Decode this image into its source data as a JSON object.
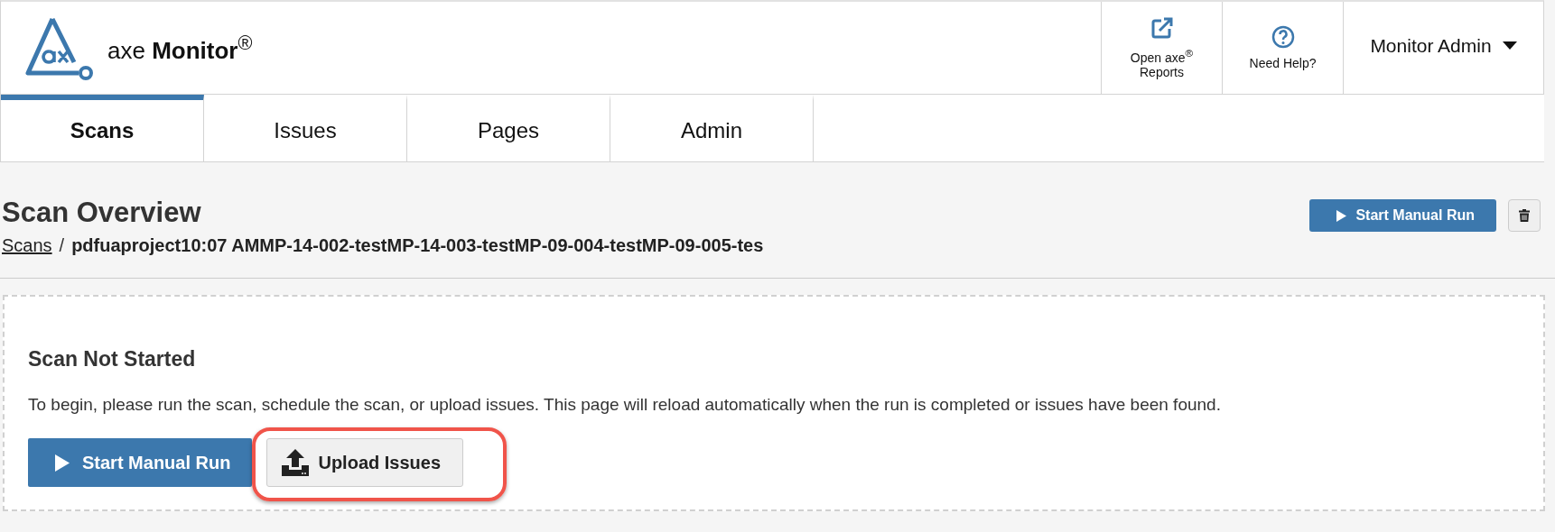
{
  "header": {
    "logo_text": "axe **Monitor**$^{®}$",
    "actions": [
      {
        "kind": "external",
        "label": "Open axe$^{®}$ Reports"
      },
      {
        "kind": "help",
        "label": "Need Help?"
      }
    ],
    "user_menu": "Monitor Admin"
  },
  "tabs": [
    {
      "label": "Scans",
      "selected": true
    },
    {
      "label": "Issues",
      "selected": false
    },
    {
      "label": "Pages",
      "selected": false
    },
    {
      "label": "Admin",
      "selected": false
    }
  ],
  "page": {
    "title": "Scan Overview",
    "breadcrumb": {
      "link": "Scans",
      "separator": "/",
      "current": "pdfuaproject10:07 AMMP-14-002-testMP-14-003-testMP-09-004-testMP-09-005-tes"
    },
    "run_button": "Start Manual Run"
  },
  "panel": {
    "heading": "Scan Not Started",
    "message": "To begin, please run the scan, schedule the scan, or upload issues. This page will reload automatically when the run is completed or issues have been found.",
    "run_button": "Start Manual Run",
    "upload_button": "Upload Issues",
    "upload_highlighted": true
  }
}
